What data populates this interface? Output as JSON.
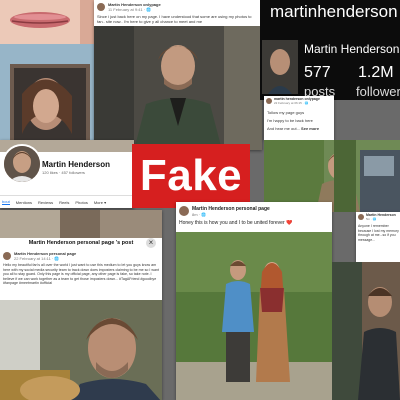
{
  "collage": {
    "stamp_label": "Fake",
    "stamp_color": "#d61f1f"
  },
  "post_top": {
    "author": "Martin Henderson onlypage",
    "meta": "11 February at 9:41 · 🌐",
    "text": "Since i just back here on my page. I have understood that some are using my photos to fan.. site now.. I'm here to give y all chance to meet and me"
  },
  "dark_profile": {
    "name": "martinhenderson",
    "subname": "Martin Henderson",
    "stat1_num": "577",
    "stat1_lbl": "posts",
    "stat2_num": "1.2M",
    "stat2_lbl": "follower"
  },
  "post_mid_right": {
    "author": "martin henderson onlypage",
    "meta": "22 February at 06:15 · 🌐",
    "line1": "Tollow my page guys",
    "line2": "I'm happy to be back here",
    "line3": "And hear me out...",
    "see_more": "See more"
  },
  "fb_profile": {
    "name": "Martin Henderson",
    "sub": "120 likes · 457 followers",
    "tabs": [
      "bout",
      "Mentions",
      "Reviews",
      "Reels",
      "Photos",
      "More ▾"
    ]
  },
  "post_personal": {
    "header": "Martin Henderson personal page 's post",
    "author": "Martin Henderson personal page",
    "meta": "22 February at 14:11 · 🌐",
    "text": "Hello my beautiful fan's all over the world I just want to use this medium to let you guys know am here with my social media security team to track down does imposters claiming to be me so I want you all to stay guard. Only this page is my official page, any other page is fake, so take note. I believe if we can work together as a team to get those imposters down... #TagAFriend #goodbye #fanpage #meetmartin #official",
    "close": "×"
  },
  "post_center": {
    "author": "Martin Henderson personal page",
    "meta": "8m · 🌐",
    "text": "Honey this is how you and I to be united forever ❤️"
  },
  "post_far_right": {
    "author": "Martin Henderson",
    "meta": "5m · 🌐",
    "text": "Anyone I remember because I lost my memory through at me...so if you message..."
  }
}
